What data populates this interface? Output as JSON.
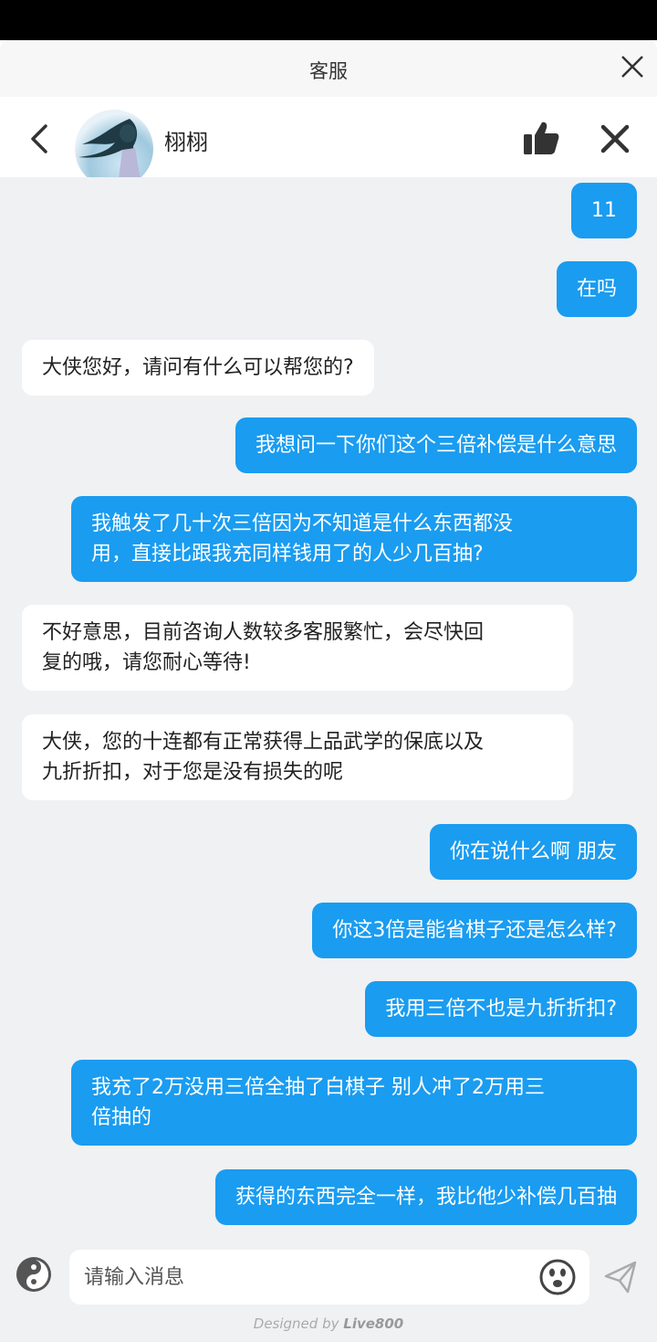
{
  "window": {
    "title": "客服"
  },
  "header": {
    "agent_name": "栩栩"
  },
  "messages": [
    {
      "side": "right",
      "text": "11"
    },
    {
      "side": "right",
      "text": "在吗"
    },
    {
      "side": "left",
      "text": "大侠您好，请问有什么可以帮您的?"
    },
    {
      "side": "right",
      "text": "我想问一下你们这个三倍补偿是什么意思"
    },
    {
      "side": "right",
      "line1": "我触发了几十次三倍因为不知道是什么东西都没",
      "line2": "用，直接比跟我充同样钱用了的人少几百抽?"
    },
    {
      "side": "left",
      "line1": "不好意思，目前咨询人数较多客服繁忙，会尽快回",
      "line2": "复的哦，请您耐心等待!"
    },
    {
      "side": "left",
      "line1": "大侠，您的十连都有正常获得上品武学的保底以及",
      "line2": "九折折扣，对于您是没有损失的呢"
    },
    {
      "side": "right",
      "text": "你在说什么啊 朋友"
    },
    {
      "side": "right",
      "text": "你这3倍是能省棋子还是怎么样?"
    },
    {
      "side": "right",
      "text": "我用三倍不也是九折折扣?"
    },
    {
      "side": "right",
      "line1": "我充了2万没用三倍全抽了白棋子 别人冲了2万用三",
      "line2": "倍抽的"
    },
    {
      "side": "right",
      "text": "获得的东西完全一样，我比他少补偿几百抽"
    }
  ],
  "composer": {
    "placeholder": "请输入消息"
  },
  "footer": {
    "designed_by": "Designed by",
    "brand": "Live800"
  },
  "colors": {
    "bubble_right": "#1a9cf0",
    "bubble_left": "#ffffff",
    "chat_bg": "#f0f1f3"
  }
}
